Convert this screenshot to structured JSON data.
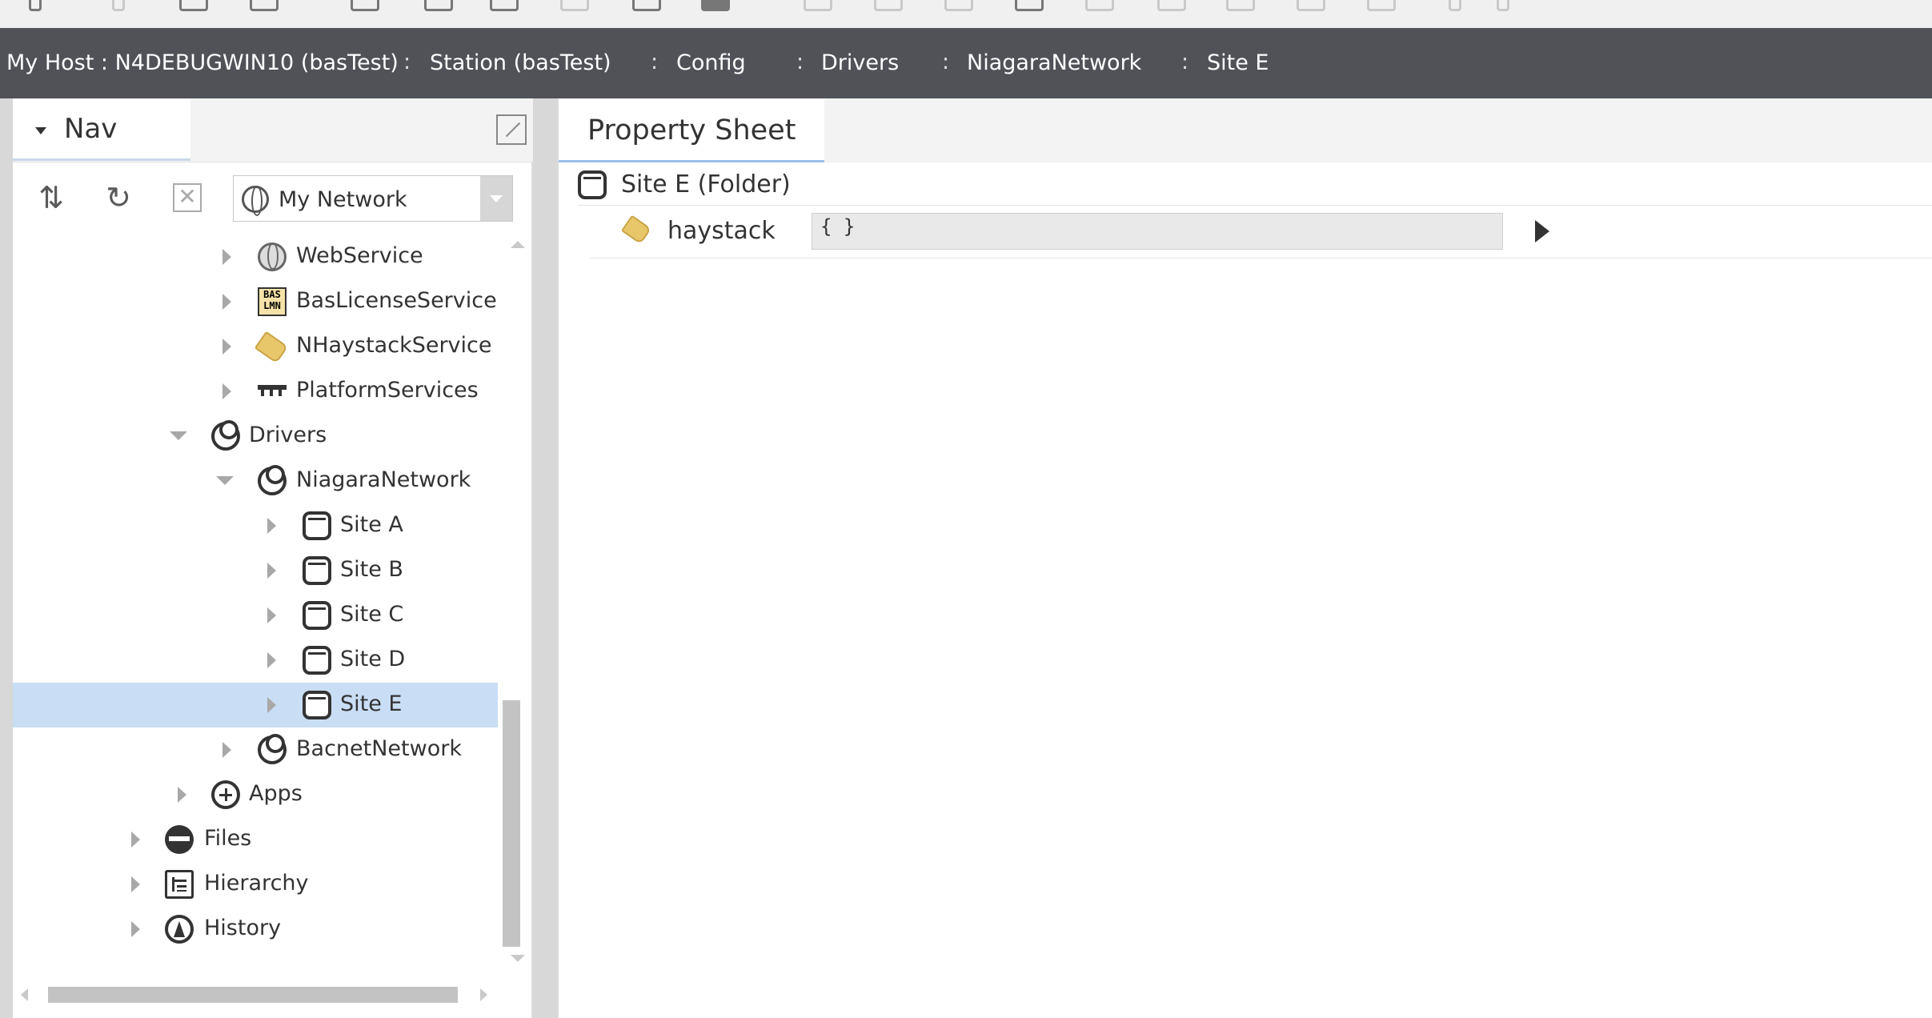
{
  "breadcrumb": {
    "items": [
      "My Host : N4DEBUGWIN10 (basTest)",
      "Station (basTest)",
      "Config",
      "Drivers",
      "NiagaraNetwork",
      "Site E"
    ],
    "separator": ":"
  },
  "nav": {
    "title": "Nav",
    "network_select": "My Network",
    "tree": [
      {
        "label": "WebService",
        "icon": "web-service-icon"
      },
      {
        "label": "BasLicenseService",
        "icon": "license-icon",
        "icon_text": "BAS LMN"
      },
      {
        "label": "NHaystackService",
        "icon": "tag-icon"
      },
      {
        "label": "PlatformServices",
        "icon": "platform-icon"
      },
      {
        "label": "Drivers",
        "icon": "driver-icon"
      },
      {
        "label": "NiagaraNetwork",
        "icon": "driver-icon"
      },
      {
        "label": "Site A",
        "icon": "folder-icon"
      },
      {
        "label": "Site B",
        "icon": "folder-icon"
      },
      {
        "label": "Site C",
        "icon": "folder-icon"
      },
      {
        "label": "Site D",
        "icon": "folder-icon"
      },
      {
        "label": "Site E",
        "icon": "folder-icon",
        "selected": true
      },
      {
        "label": "BacnetNetwork",
        "icon": "driver-icon"
      },
      {
        "label": "Apps",
        "icon": "apps-icon"
      },
      {
        "label": "Files",
        "icon": "files-icon"
      },
      {
        "label": "Hierarchy",
        "icon": "hierarchy-icon"
      },
      {
        "label": "History",
        "icon": "history-icon"
      }
    ]
  },
  "main": {
    "tab_label": "Property Sheet",
    "header_label": "Site E  (Folder)",
    "properties": [
      {
        "name": "haystack",
        "value": "{ }"
      }
    ]
  },
  "colors": {
    "breadcrumb_bg": "#505258",
    "selection": "#c9def5",
    "tag": "#e8c66a"
  }
}
